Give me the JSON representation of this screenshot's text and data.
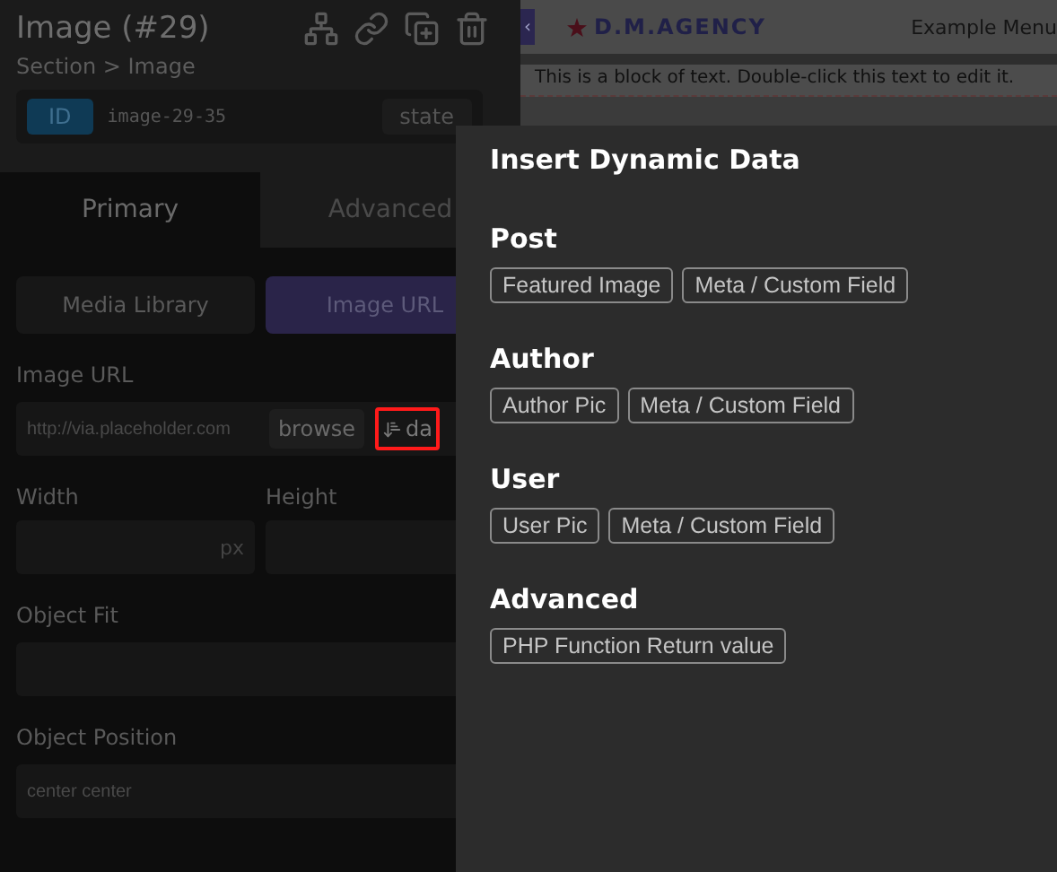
{
  "panel": {
    "title": "Image (#29)",
    "breadcrumb": "Section > Image",
    "id_badge": "ID",
    "id_value": "image-29-35",
    "state_button": "state",
    "tabs": [
      {
        "label": "Primary",
        "selected": true
      },
      {
        "label": "Advanced",
        "selected": false
      }
    ],
    "source_tabs": [
      {
        "label": "Media Library",
        "selected": false
      },
      {
        "label": "Image URL",
        "selected": true
      }
    ],
    "image_url": {
      "label": "Image URL",
      "placeholder": "http://via.placeholder.com",
      "browse": "browse",
      "data_button": "da",
      "highlighted": true
    },
    "width": {
      "label": "Width",
      "unit": "px"
    },
    "height": {
      "label": "Height"
    },
    "object_fit": {
      "label": "Object Fit"
    },
    "object_position": {
      "label": "Object Position",
      "placeholder": "center center"
    }
  },
  "canvas": {
    "handle": "‹",
    "logo": "D.M.AGENCY",
    "menu": "Example Menu",
    "text": "This is a block of text. Double-click this text to edit it."
  },
  "popup": {
    "title": "Insert Dynamic Data",
    "sections": [
      {
        "heading": "Post",
        "items": [
          "Featured Image",
          "Meta / Custom Field"
        ]
      },
      {
        "heading": "Author",
        "items": [
          "Author Pic",
          "Meta / Custom Field"
        ]
      },
      {
        "heading": "User",
        "items": [
          "User Pic",
          "Meta / Custom Field"
        ]
      },
      {
        "heading": "Advanced",
        "items": [
          "PHP Function Return value"
        ]
      }
    ]
  }
}
